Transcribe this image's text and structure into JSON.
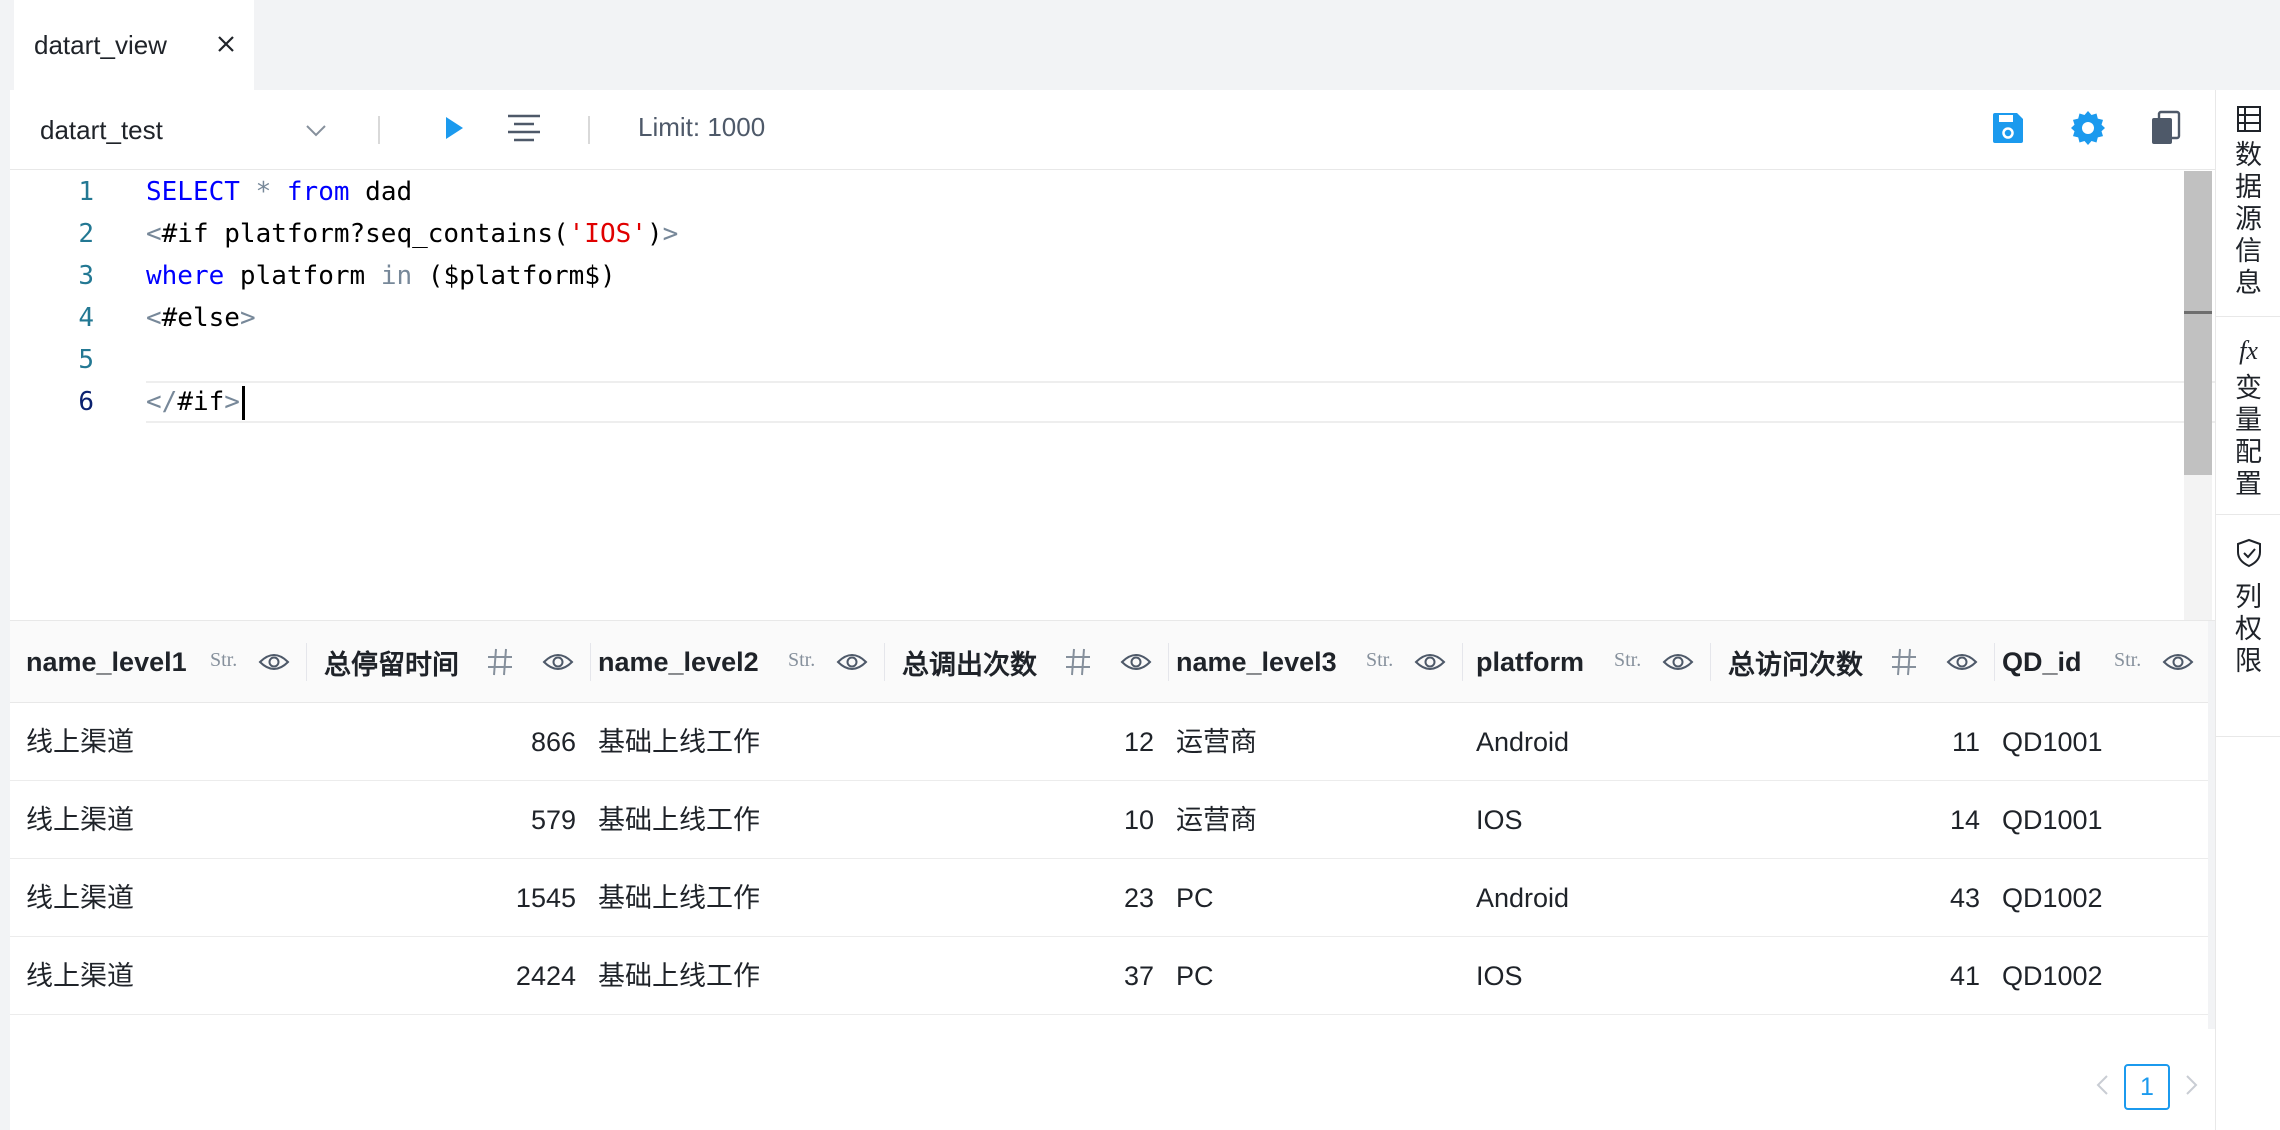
{
  "tab": {
    "title": "datart_view"
  },
  "toolbar": {
    "source": "datart_test",
    "limit": "Limit: 1000",
    "accent": "#1b9aee"
  },
  "editor": {
    "line_numbers": [
      "1",
      "2",
      "3",
      "4",
      "5",
      "6"
    ],
    "lines": [
      [
        {
          "t": "SELECT",
          "c": "kw"
        },
        {
          "t": " ",
          "c": ""
        },
        {
          "t": "*",
          "c": "op"
        },
        {
          "t": " ",
          "c": ""
        },
        {
          "t": "from",
          "c": "kw"
        },
        {
          "t": " dad",
          "c": ""
        }
      ],
      [
        {
          "t": "<",
          "c": "op"
        },
        {
          "t": "#if platform?seq_contains(",
          "c": ""
        },
        {
          "t": "'IOS'",
          "c": "str"
        },
        {
          "t": ")",
          "c": ""
        },
        {
          "t": ">",
          "c": "op"
        }
      ],
      [
        {
          "t": "where",
          "c": "kw"
        },
        {
          "t": " platform ",
          "c": ""
        },
        {
          "t": "in",
          "c": "op"
        },
        {
          "t": " ($platform$)",
          "c": ""
        }
      ],
      [
        {
          "t": "<",
          "c": "op"
        },
        {
          "t": "#else",
          "c": ""
        },
        {
          "t": ">",
          "c": "op"
        }
      ],
      [],
      [
        {
          "t": "</",
          "c": "op"
        },
        {
          "t": "#if",
          "c": ""
        },
        {
          "t": ">",
          "c": "op"
        }
      ]
    ]
  },
  "table": {
    "columns": [
      {
        "label": "name_level1",
        "type": "Str."
      },
      {
        "label": "总停留时间",
        "type": "#"
      },
      {
        "label": "name_level2",
        "type": "Str."
      },
      {
        "label": "总调出次数",
        "type": "#"
      },
      {
        "label": "name_level3",
        "type": "Str."
      },
      {
        "label": "platform",
        "type": "Str."
      },
      {
        "label": "总访问次数",
        "type": "#"
      },
      {
        "label": "QD_id",
        "type": "Str."
      }
    ],
    "rows": [
      [
        "线上渠道",
        "866",
        "基础上线工作",
        "12",
        "运营商",
        "Android",
        "11",
        "QD1001"
      ],
      [
        "线上渠道",
        "579",
        "基础上线工作",
        "10",
        "运营商",
        "IOS",
        "14",
        "QD1001"
      ],
      [
        "线上渠道",
        "1545",
        "基础上线工作",
        "23",
        "PC",
        "Android",
        "43",
        "QD1002"
      ],
      [
        "线上渠道",
        "2424",
        "基础上线工作",
        "37",
        "PC",
        "IOS",
        "41",
        "QD1002"
      ]
    ]
  },
  "pagination": {
    "current_page": "1"
  },
  "side_panel": {
    "items": [
      {
        "label": "数据源信息",
        "icon": "table-icon"
      },
      {
        "label": "变量配置",
        "icon": "fx-icon"
      },
      {
        "label": "列权限",
        "icon": "shield-check-icon"
      }
    ]
  }
}
